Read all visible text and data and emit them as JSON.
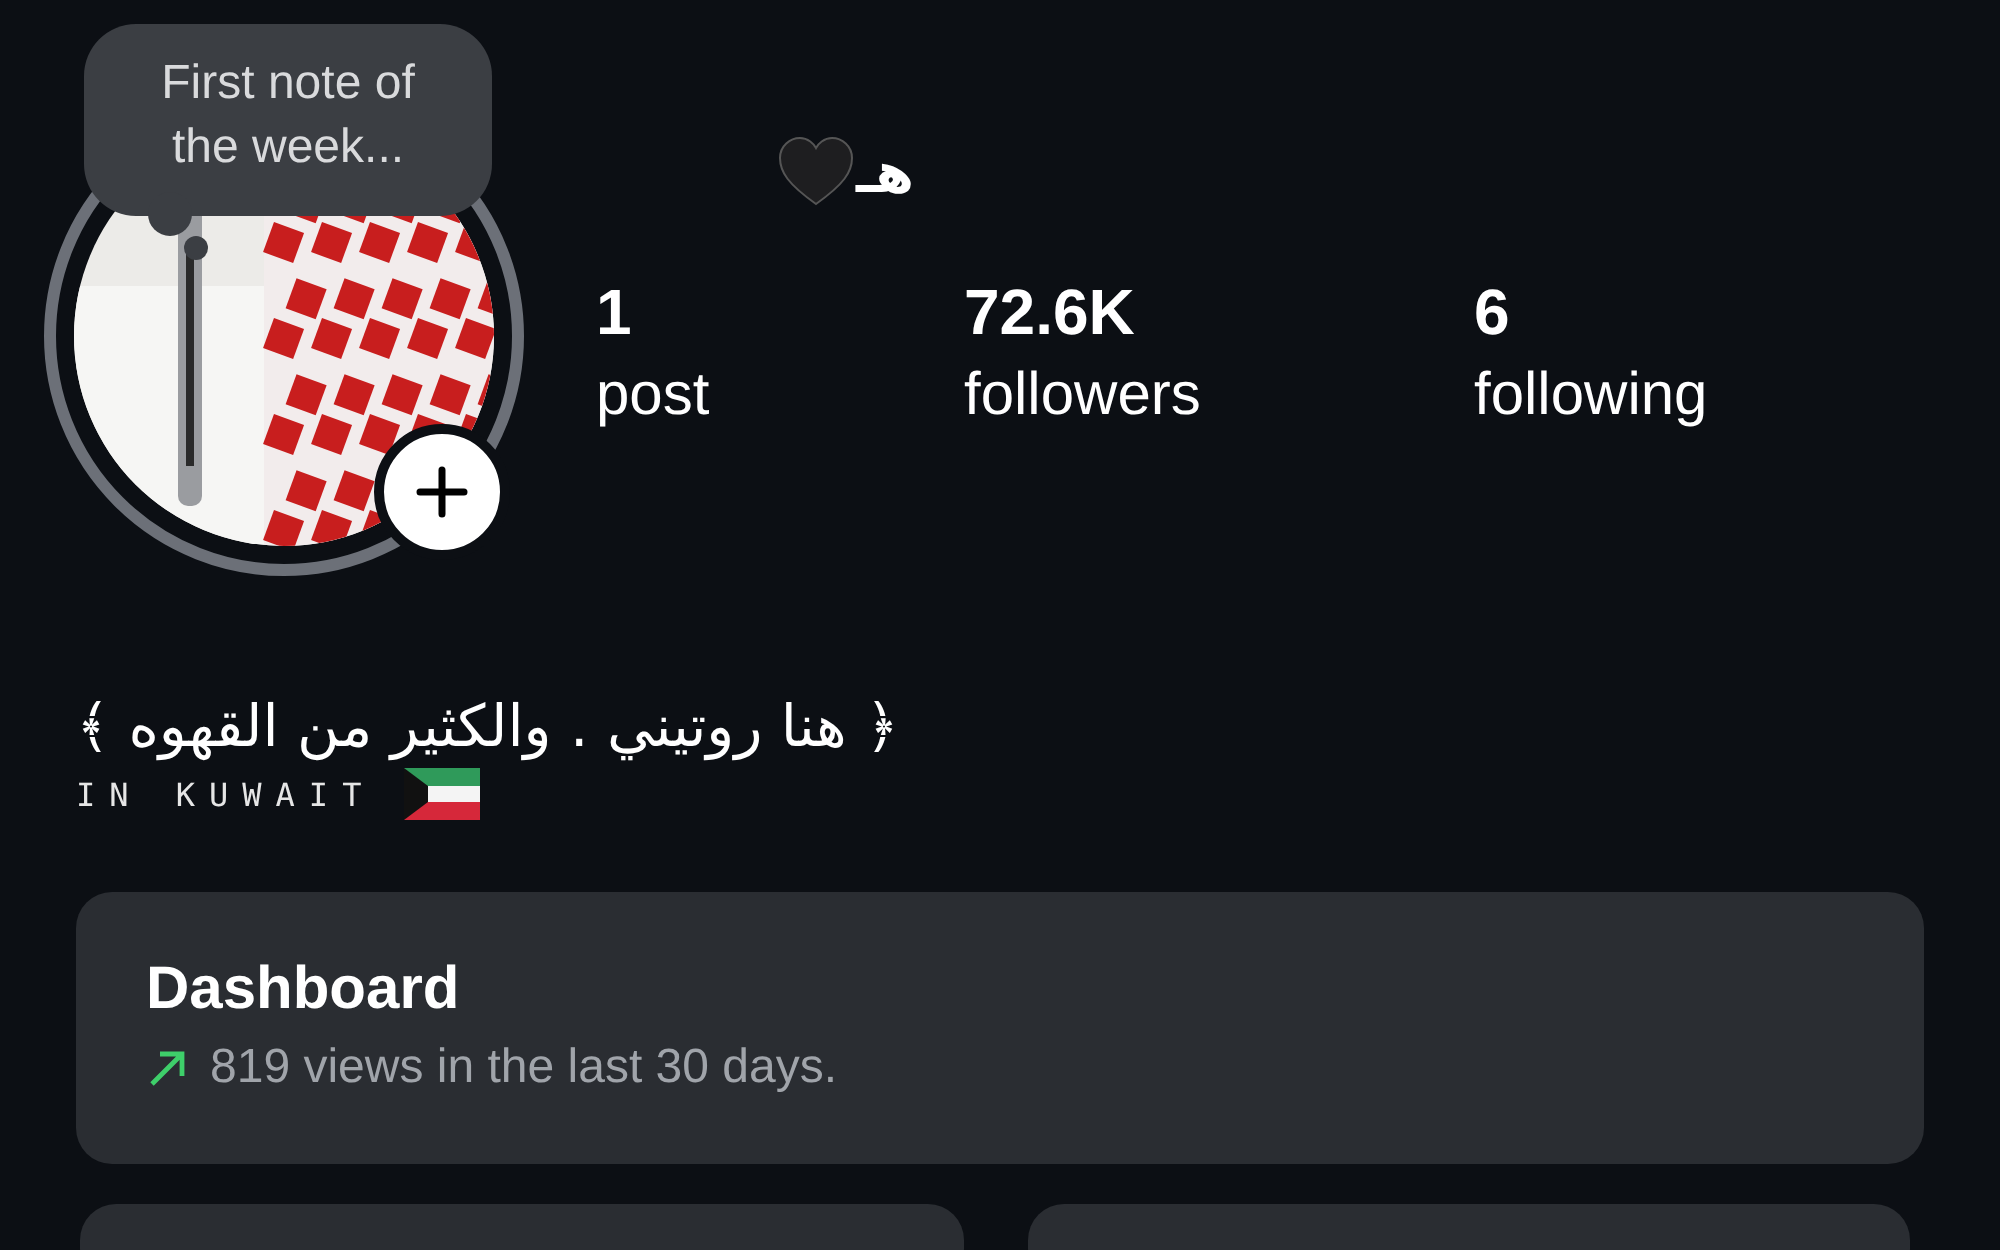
{
  "note": {
    "text": "First note of the week..."
  },
  "profile": {
    "name": "هـ"
  },
  "stats": [
    {
      "value": "1",
      "label": "post"
    },
    {
      "value": "72.6K",
      "label": "followers"
    },
    {
      "value": "6",
      "label": "following"
    }
  ],
  "bio": {
    "text": "﴿ هنا روتيني . والكثير من القهوه ﴾",
    "location": "IN KUWAIT"
  },
  "dashboard": {
    "title": "Dashboard",
    "subtitle": "819 views in the last 30 days."
  }
}
